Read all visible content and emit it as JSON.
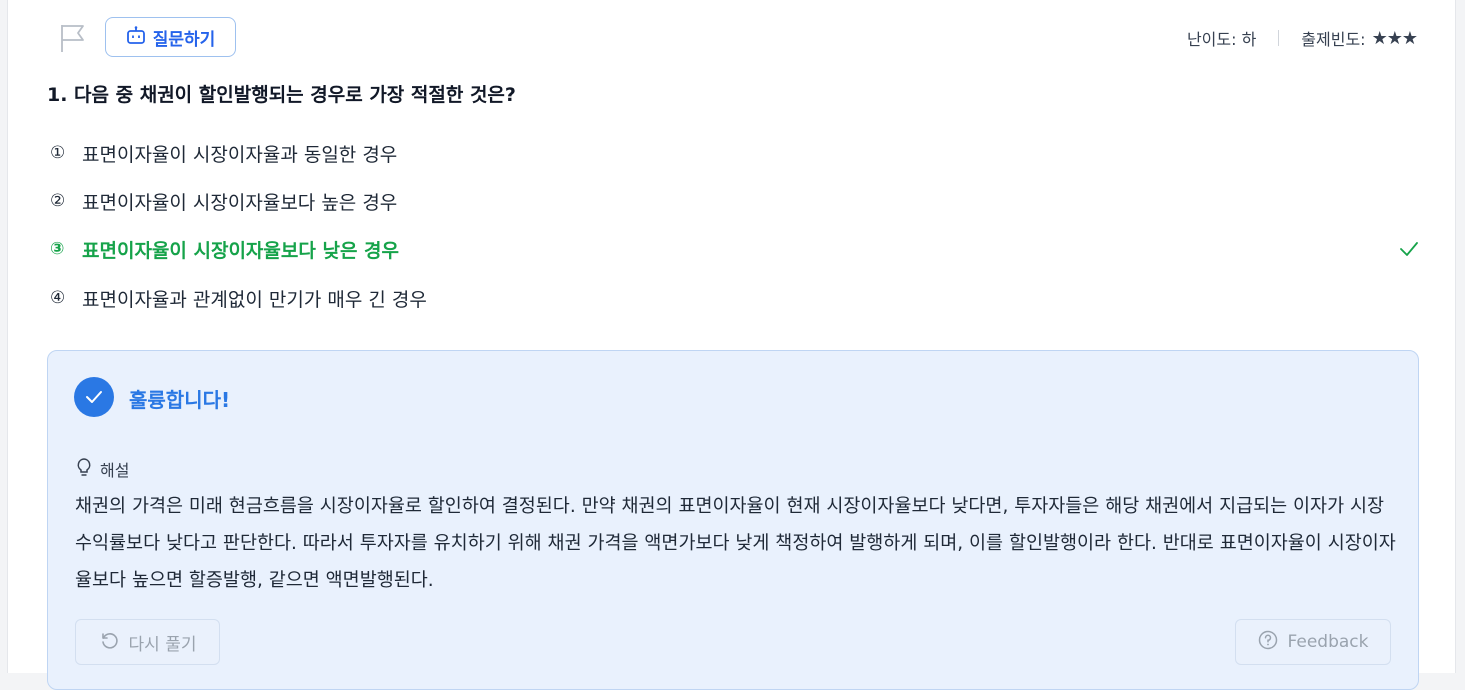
{
  "header": {
    "ask_label": "질문하기",
    "difficulty": "난이도: 하",
    "frequency": "출제빈도:",
    "frequency_stars": "★★★"
  },
  "question": {
    "text": "1. 다음 중 채권이 할인발행되는 경우로 가장 적절한 것은?",
    "options": [
      {
        "num": "①",
        "label": "표면이자율이 시장이자율과 동일한 경우"
      },
      {
        "num": "②",
        "label": "표면이자율이 시장이자율보다 높은 경우"
      },
      {
        "num": "③",
        "label": "표면이자율이 시장이자율보다 낮은 경우"
      },
      {
        "num": "④",
        "label": "표면이자율과 관계없이 만기가 매우 긴 경우"
      }
    ],
    "correct_index": 2
  },
  "result": {
    "title": "훌륭합니다!",
    "explanation_label": "해설",
    "explanation": "채권의 가격은 미래 현금흐름을 시장이자율로 할인하여 결정된다. 만약 채권의 표면이자율이 현재 시장이자율보다 낮다면, 투자자들은 해당 채권에서 지급되는 이자가 시장수익률보다 낮다고 판단한다. 따라서 투자자를 유치하기 위해 채권 가격을 액면가보다 낮게 책정하여 발행하게 되며, 이를 할인발행이라 한다. 반대로 표면이자율이 시장이자율보다 높으면 할증발행, 같으면 액면발행된다.",
    "retry_label": "다시 풀기",
    "feedback_label": "Feedback"
  },
  "colors": {
    "accent": "#2a78e4",
    "correct": "#16a34a",
    "result_bg": "#e9f1fd"
  }
}
